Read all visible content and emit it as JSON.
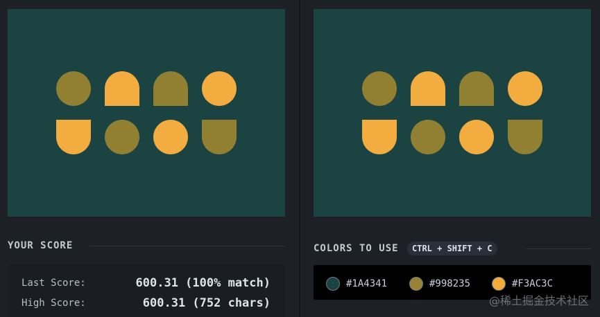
{
  "score": {
    "title": "YOUR SCORE",
    "last_label": "Last Score:",
    "last_value": "600.31 (100% match)",
    "high_label": "High Score:",
    "high_value": "600.31 (752 chars)"
  },
  "colors": {
    "title": "COLORS TO USE",
    "shortcut": "CTRL + SHIFT + C",
    "swatches": [
      {
        "hex": "#1A4341",
        "color": "#1A4341"
      },
      {
        "hex": "#998235",
        "color": "#998235"
      },
      {
        "hex": "#F3AC3C",
        "color": "#F3AC3C"
      }
    ]
  },
  "canvas": {
    "background": "#1A4341",
    "shape_colors": [
      "#918032",
      "#f2ac3f"
    ],
    "shapes_row1": [
      "circle",
      "dome",
      "dome",
      "circle"
    ],
    "shapes_row2": [
      "cup",
      "circle",
      "circle",
      "cup"
    ],
    "colors_row1": [
      "olive",
      "orange",
      "olive",
      "orange"
    ],
    "colors_row2": [
      "orange",
      "olive",
      "orange",
      "olive"
    ]
  },
  "watermark": "@稀土掘金技术社区"
}
